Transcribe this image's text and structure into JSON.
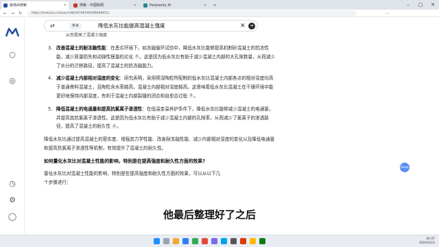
{
  "browser": {
    "tabs": [
      {
        "label": "秘塔AI搜索",
        "active": true,
        "favicon_color": "#2b4ea2"
      },
      {
        "label": "搜索 - 中国知网",
        "active": false,
        "favicon_color": "#c0392b"
      },
      {
        "label": "Perplexity AI",
        "active": false,
        "favicon_color": "#1f8a8a"
      }
    ],
    "url": "https://metaso.cn/search/8639796590596669651/"
  },
  "search": {
    "chip": "学术",
    "query": "降低水灰比能提高混凝土强度"
  },
  "partial_line": "从而提高了混凝土强度",
  "items": [
    {
      "num": "3.",
      "title": "改善混凝土的耐冻融性能",
      "body": "：在恶劣环境下，如冻融循环试验中，降低水灰比能够提高机制砂混凝土的抗冻性能，减少质量损失和动弹性模量的劣化",
      "tail": "。这是因为低水灰比有助于减少混凝土内部的大孔隙数量，从而减少了水分的迁移路径，提高了混凝土的抗冻融能力。",
      "cite": "6"
    },
    {
      "num": "4.",
      "title": "减少混凝土内部相对湿度的变化",
      "body": "：研究表明，采用预湿陶粒所配制的低水灰比混凝土内部各点的相对湿度均高于普通骨料混凝土，且陶粒含水率越高，混凝土内部相对湿度越高。这意味着低水灰比混凝土在干燥环境中能更好地保持内部湿度，有利于混凝土内部裂缝的闭合和自愈合过程",
      "tail": "。",
      "cite": "6"
    },
    {
      "num": "5.",
      "title": "降低混凝土的电通量和提高抗氯离子渗透性",
      "body": "：在低温变温养护条件下，降低水灰比能够减少混凝土的电通量，并提高其抗氯离子渗透性。这是因为低水灰比有助于减少混凝土内部的孔隙率，从而减少了氯离子的渗透路径，提高了混凝土的耐久性",
      "tail": "。",
      "cite": "6"
    }
  ],
  "summary": "降低水灰比通过提高混凝土的密实度、增强其力学性能、改善耐冻融性能、减少内部相对湿度的变化以及降低电通量和提高抗氯离子渗透性等机制，有效提升了混凝土的耐久性。",
  "question": "如何量化水灰比对混凝土性能的影响，特别是在提高强度和耐久性方面的效果?",
  "answer_start_1": "量化水灰比对混凝土性能的影响，特别是在提高强度和耐久性方面的效果，可以从以下几",
  "answer_start_2": "个步骤进行：",
  "subtitle": "他最后整理好了之后",
  "float_badge": "DeepL",
  "tray": {
    "time": "16:47",
    "date": "2024/5/23"
  },
  "theme": {
    "accent": "#2b4ea2",
    "badge": "#5b8def"
  }
}
